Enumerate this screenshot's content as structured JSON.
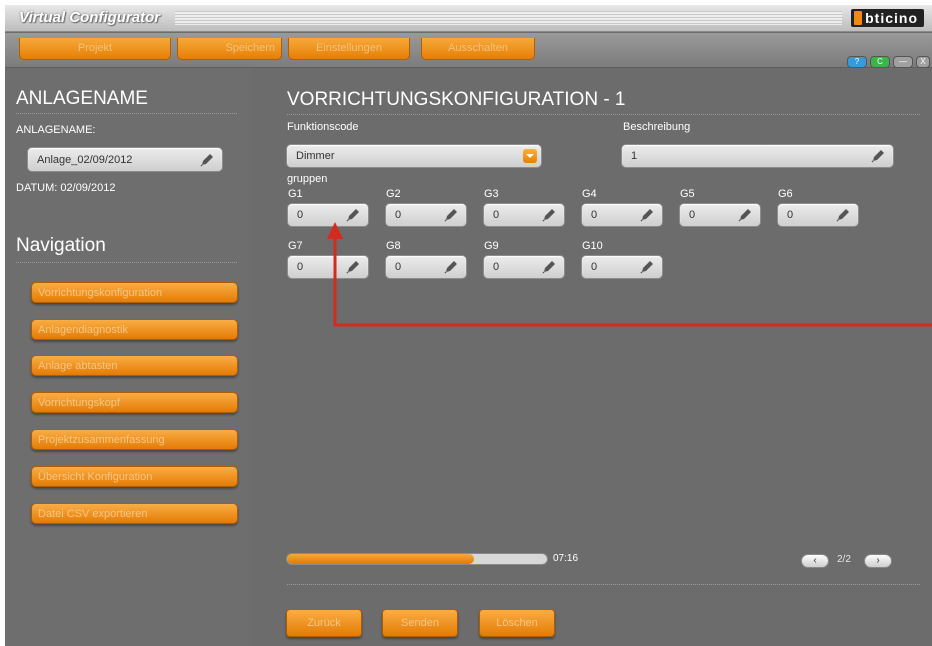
{
  "app": {
    "title": "Virtual Configurator",
    "brand": "bticino"
  },
  "menu": [
    {
      "label": "Projekt"
    },
    {
      "label": "Speichern"
    },
    {
      "label": "Einstellungen"
    },
    {
      "label": "Ausschalten"
    }
  ],
  "window_buttons": [
    {
      "label": "?",
      "color": "#3a9ad9",
      "icon": "help-icon"
    },
    {
      "label": "C",
      "color": "#3bb54a",
      "icon": "connect-icon"
    },
    {
      "label": "—",
      "color": "#a0a0a0",
      "icon": "minimize-icon"
    },
    {
      "label": "X",
      "color": "#a0a0a0",
      "icon": "close-icon"
    }
  ],
  "left": {
    "heading": "ANLAGENAME",
    "name_label": "ANLAGENAME:",
    "name_value": "Anlage_02/09/2012",
    "date_label": "DATUM: 02/09/2012",
    "nav_heading": "Navigation",
    "nav_items": [
      "Vorrichtungskonfiguration",
      "Anlagendiagnostik",
      "Anlage abtasten",
      "Vorrichtungskopf",
      "Projektzusammenfassung",
      "Übersicht Konfiguration",
      "Datei CSV exportieren"
    ]
  },
  "main": {
    "heading": "VORRICHTUNGSKONFIGURATION - 1",
    "funktionscode_label": "Funktionscode",
    "funktionscode_value": "Dimmer",
    "beschreibung_label": "Beschreibung",
    "beschreibung_value": "1",
    "gruppen_label": "gruppen",
    "groups": [
      {
        "label": "G1",
        "value": "0"
      },
      {
        "label": "G2",
        "value": "0"
      },
      {
        "label": "G3",
        "value": "0"
      },
      {
        "label": "G4",
        "value": "0"
      },
      {
        "label": "G5",
        "value": "0"
      },
      {
        "label": "G6",
        "value": "0"
      },
      {
        "label": "G7",
        "value": "0"
      },
      {
        "label": "G8",
        "value": "0"
      },
      {
        "label": "G9",
        "value": "0"
      },
      {
        "label": "G10",
        "value": "0"
      }
    ],
    "progress_fraction": 0.72,
    "progress_time": "07:16",
    "page_indicator": "2/2",
    "buttons": {
      "back": "Zurück",
      "send": "Senden",
      "delete": "Löschen"
    }
  },
  "colors": {
    "accent": "#f08a10",
    "arrow": "#d42b1e",
    "panel": "#6d6d6d"
  }
}
